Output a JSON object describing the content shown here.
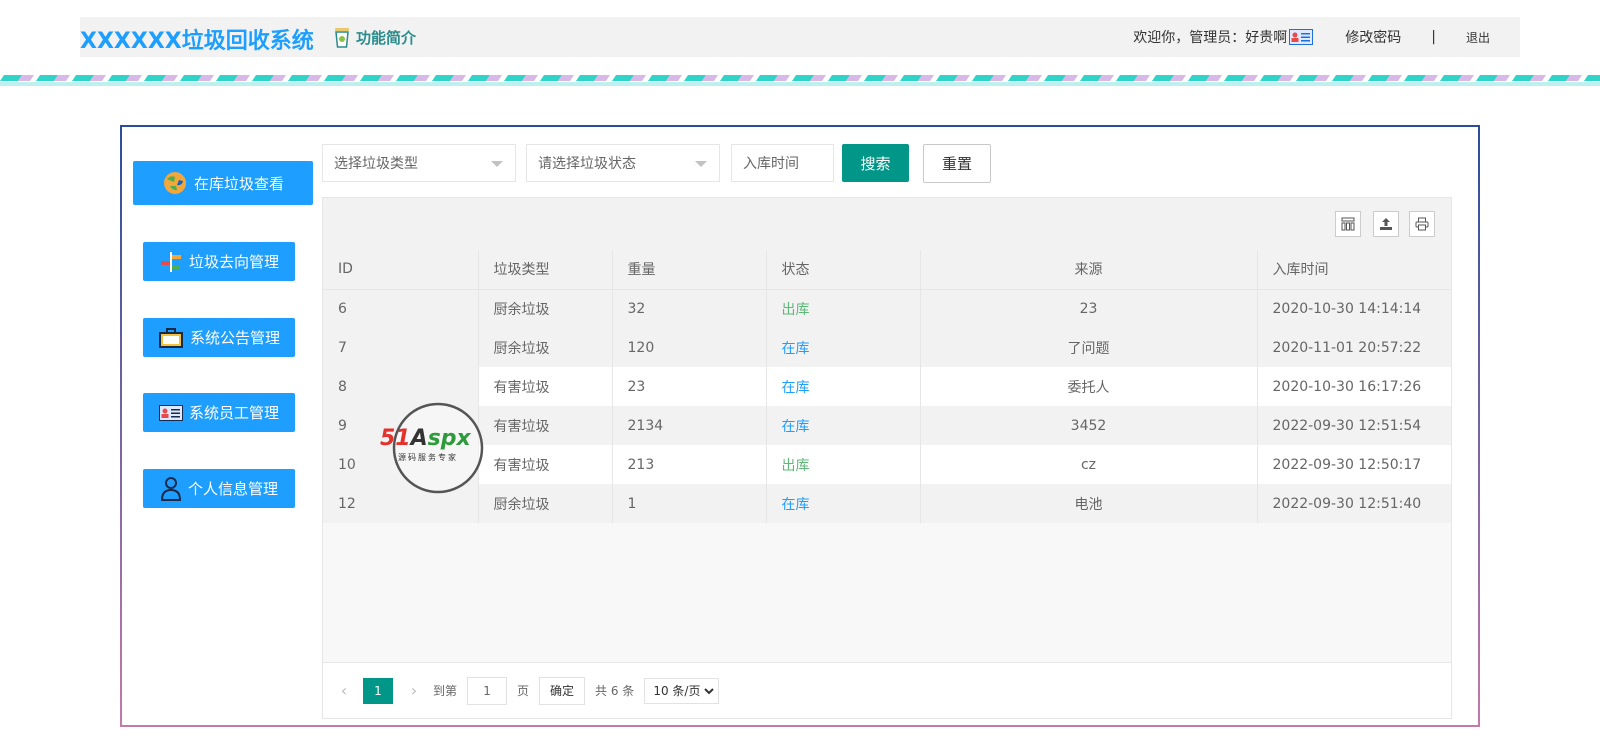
{
  "header": {
    "brand": "XXXXXX垃圾回收系统",
    "intro_label": "功能简介",
    "welcome": "欢迎你，管理员：好贵啊",
    "change_password": "修改密码",
    "separator": "|",
    "logout": "退出"
  },
  "sidebar": {
    "items": [
      {
        "label": "在库垃圾查看",
        "icon": "globe-recycle-icon"
      },
      {
        "label": "垃圾去向管理",
        "icon": "signpost-icon"
      },
      {
        "label": "系统公告管理",
        "icon": "briefcase-icon"
      },
      {
        "label": "系统员工管理",
        "icon": "id-card-icon"
      },
      {
        "label": "个人信息管理",
        "icon": "user-icon"
      }
    ]
  },
  "filters": {
    "type_placeholder": "选择垃圾类型",
    "status_placeholder": "请选择垃圾状态",
    "date_placeholder": "入库时间",
    "search_label": "搜索",
    "reset_label": "重置"
  },
  "table": {
    "columns": [
      "ID",
      "垃圾类型",
      "重量",
      "状态",
      "来源",
      "入库时间"
    ],
    "rows": [
      {
        "id": "6",
        "type": "厨余垃圾",
        "weight": "32",
        "status": "出库",
        "source": "23",
        "time": "2020-10-30 14:14:14"
      },
      {
        "id": "7",
        "type": "厨余垃圾",
        "weight": "120",
        "status": "在库",
        "source": "了问题",
        "time": "2020-11-01 20:57:22"
      },
      {
        "id": "8",
        "type": "有害垃圾",
        "weight": "23",
        "status": "在库",
        "source": "委托人",
        "time": "2020-10-30 16:17:26"
      },
      {
        "id": "9",
        "type": "有害垃圾",
        "weight": "2134",
        "status": "在库",
        "source": "3452",
        "time": "2022-09-30 12:51:54"
      },
      {
        "id": "10",
        "type": "有害垃圾",
        "weight": "213",
        "status": "出库",
        "source": "cz",
        "time": "2022-09-30 12:50:17"
      },
      {
        "id": "12",
        "type": "厨余垃圾",
        "weight": "1",
        "status": "在库",
        "source": "电池",
        "time": "2022-09-30 12:51:40"
      }
    ]
  },
  "pager": {
    "current": "1",
    "goto_label": "到第",
    "goto_value": "1",
    "page_unit": "页",
    "confirm": "确定",
    "total": "共 6 条",
    "page_size": "10 条/页"
  },
  "watermark": {
    "brand": "51Aspx",
    "tagline": "源码服务专家"
  },
  "colors": {
    "primary": "#1e9fff",
    "teal": "#009688",
    "status_out": "#5fb878",
    "status_in": "#1e9fff"
  }
}
